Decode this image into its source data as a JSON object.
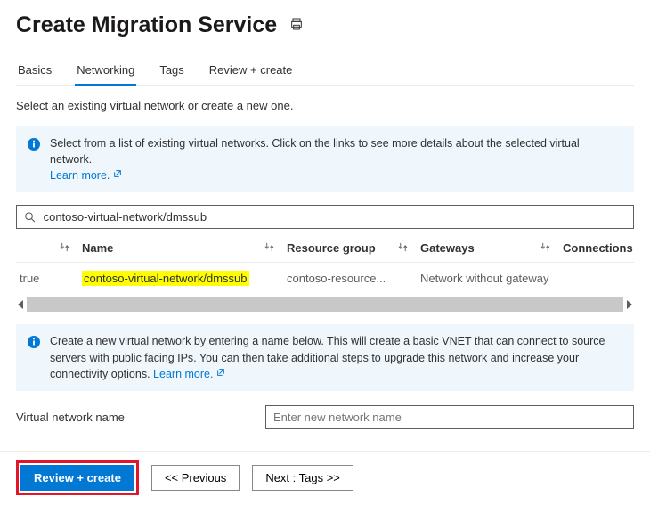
{
  "header": {
    "title": "Create Migration Service"
  },
  "tabs": [
    {
      "label": "Basics",
      "active": false
    },
    {
      "label": "Networking",
      "active": true
    },
    {
      "label": "Tags",
      "active": false
    },
    {
      "label": "Review + create",
      "active": false
    }
  ],
  "intro": "Select an existing virtual network or create a new one.",
  "infobox1": {
    "text": "Select from a list of existing virtual networks. Click on the links to see more details about the selected virtual network.",
    "link": "Learn more."
  },
  "search": {
    "value": "contoso-virtual-network/dmssub"
  },
  "table": {
    "columns": [
      "",
      "Name",
      "Resource group",
      "Gateways",
      "Connections"
    ],
    "rows": [
      {
        "selected": "true",
        "name": "contoso-virtual-network/dmssub",
        "resource_group": "contoso-resource...",
        "gateways": "Network without gateway"
      }
    ]
  },
  "infobox2": {
    "text": "Create a new virtual network by entering a name below. This will create a basic VNET that can connect to source servers with public facing IPs. You can then take additional steps to upgrade this network and increase your connectivity options.",
    "link": "Learn more."
  },
  "vnet_form": {
    "label": "Virtual network name",
    "placeholder": "Enter new network name"
  },
  "footer": {
    "primary": "Review + create",
    "previous": "<< Previous",
    "next": "Next : Tags >>"
  }
}
